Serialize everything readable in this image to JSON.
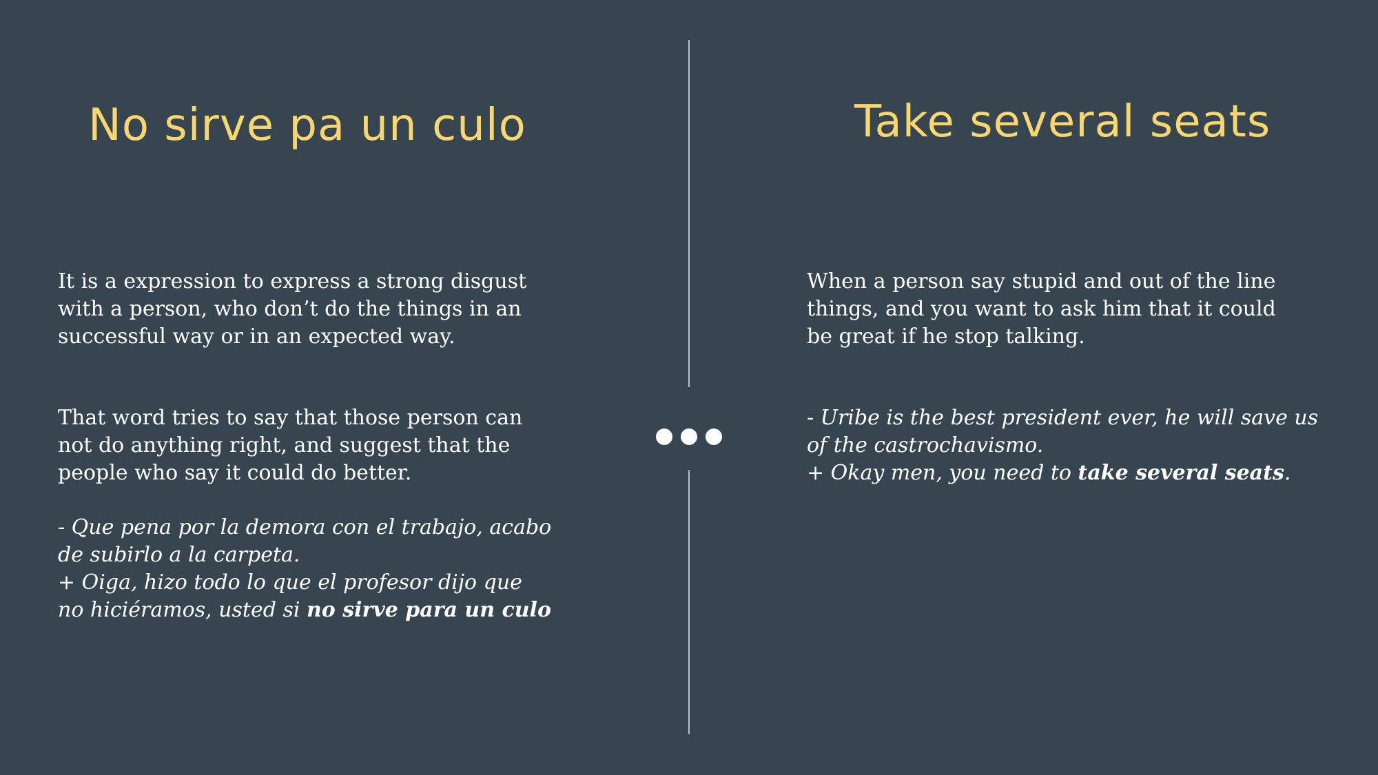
{
  "slide": {
    "left": {
      "title": "No sirve pa un culo",
      "paragraph1": "It is a expression to express a strong disgust with a person, who don’t do the things in an successful way or in an expected way.",
      "paragraph2": "That word tries to say that those person can not do anything right, and suggest that the people who say it could do better.",
      "example_line1": "- Que pena por la demora con el trabajo, acabo de subirlo a la carpeta.",
      "example_line2_prefix": "+ Oiga, hizo todo lo que el profesor dijo que no hiciéramos, usted si ",
      "example_line2_bold": "no sirve para un culo"
    },
    "right": {
      "title": "Take several seats",
      "paragraph1": "When a person say stupid and out of the line things, and you want to ask him that it could be great if he stop talking.",
      "example_line1": "- Uribe is the best president ever, he will save us of the castrochavismo.",
      "example_line2_prefix": "+ Okay men, you need to ",
      "example_line2_bold": "take several seats",
      "example_line2_suffix": "."
    }
  },
  "colors": {
    "background": "#36454f",
    "title": "#f9d770",
    "text": "#ffffff",
    "divider": "#b8c0c6"
  },
  "icons": {
    "divider_ornament": "ellipsis-dots-icon"
  }
}
